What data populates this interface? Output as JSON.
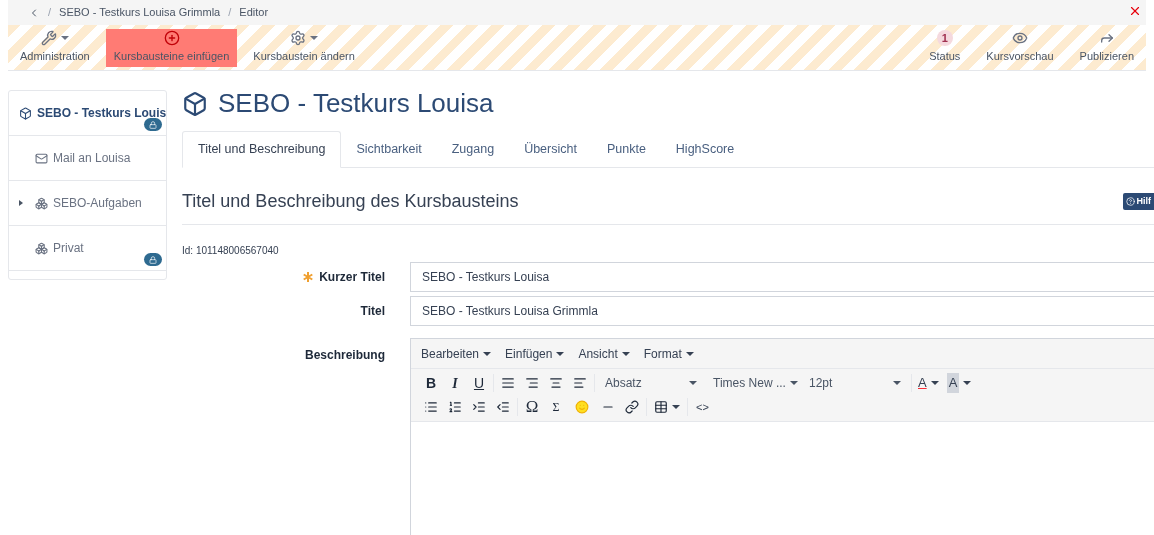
{
  "breadcrumb": {
    "separator": "/",
    "items": [
      "SEBO - Testkurs Louisa Grimmla",
      "Editor"
    ]
  },
  "toolbar": {
    "left": [
      {
        "kind": "wrench",
        "label": "Administration",
        "selected": false
      },
      {
        "kind": "plus",
        "label": "Kursbausteine einfügen",
        "selected": true
      },
      {
        "kind": "gear",
        "label": "Kursbaustein ändern",
        "selected": false
      }
    ],
    "right": [
      {
        "kind": "badge",
        "badge": "1",
        "label": "Status"
      },
      {
        "kind": "eye",
        "label": "Kursvorschau"
      },
      {
        "kind": "share",
        "label": "Publizieren"
      }
    ]
  },
  "tree": {
    "label": "SEBO - Testkurs Louis",
    "selected": true,
    "locked": true,
    "children": [
      {
        "kind": "mail",
        "label": "Mail an Louisa",
        "locked": false
      },
      {
        "kind": "group",
        "label": "SEBO-Aufgaben",
        "locked": false,
        "expanded": false
      },
      {
        "kind": "group",
        "label": "Privat",
        "locked": true
      }
    ]
  },
  "title": "SEBO - Testkurs Louisa",
  "tabs": [
    {
      "label": "Titel und Beschreibung",
      "selected": true
    },
    {
      "label": "Sichtbarkeit",
      "selected": false
    },
    {
      "label": "Zugang",
      "selected": false
    },
    {
      "label": "Übersicht",
      "selected": false
    },
    {
      "label": "Punkte",
      "selected": false
    },
    {
      "label": "HighScore",
      "selected": false
    }
  ],
  "section": {
    "title": "Titel und Beschreibung des Kursbausteins",
    "help": "Hilf"
  },
  "id_line": "Id: 101148006567040",
  "fields": [
    {
      "label": "Kurzer Titel",
      "required": true,
      "value": "SEBO - Testkurs Louisa"
    },
    {
      "label": "Titel",
      "required": false,
      "value": "SEBO - Testkurs Louisa Grimmla"
    }
  ],
  "editor": {
    "label": "Beschreibung",
    "menus": [
      "Bearbeiten",
      "Einfügen",
      "Ansicht",
      "Format"
    ],
    "format_glyphs": [
      "B",
      "I",
      "U"
    ],
    "selects": [
      "Absatz",
      "Times New ...",
      "12pt"
    ],
    "color_glyphs": [
      "A",
      "A"
    ],
    "symbol_glyphs": [
      "Ω",
      "Σ"
    ],
    "code_glyph": "<>"
  }
}
